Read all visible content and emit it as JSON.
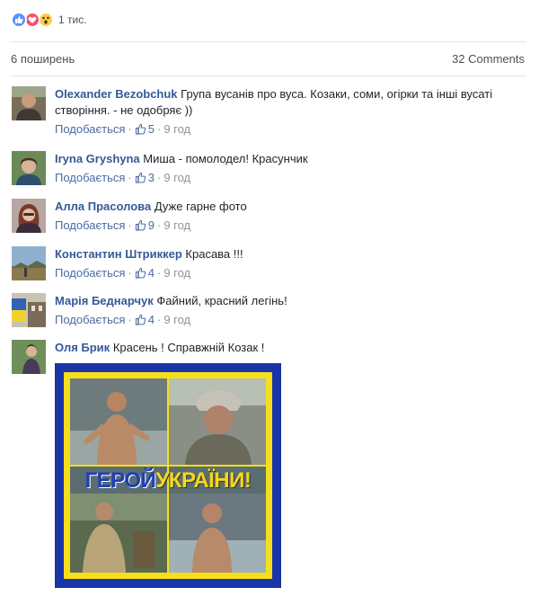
{
  "reactions": {
    "icons": [
      "like-icon",
      "love-icon",
      "wow-icon"
    ],
    "count": "1 тис."
  },
  "post_stats": {
    "shares": "6 поширень",
    "comments": "32 Comments"
  },
  "like_label": "Подобається",
  "comments": [
    {
      "author": "Olexander Bezobchuk",
      "text": "Група вусанів про вуса. Козаки, соми, огірки та інші вусаті створіння. - не одобряє ))",
      "likes": "5",
      "time": "9 год"
    },
    {
      "author": "Iryna Gryshyna",
      "text": "Миша - помолодел! Красунчик",
      "likes": "3",
      "time": "9 год"
    },
    {
      "author": "Алла Прасолова",
      "text": "Дуже гарне фото",
      "likes": "9",
      "time": "9 год"
    },
    {
      "author": "Константин Штриккер",
      "text": "Красава !!!",
      "likes": "4",
      "time": "9 год"
    },
    {
      "author": "Марія Беднарчук",
      "text": "Файний, красний легінь!",
      "likes": "4",
      "time": "9 год"
    },
    {
      "author": "Оля Брик",
      "text": "Красень ! Справжній Козак !"
    }
  ],
  "photo": {
    "banner_part1": "ГЕРОЙ",
    "banner_part2": "УКРАЇНИ!"
  },
  "colors": {
    "link": "#365899",
    "meta": "#90949c",
    "like_blue": "#5890ff",
    "love_red": "#f25268",
    "wow_yellow": "#fbcd4e",
    "frame_blue": "#1a35a8",
    "frame_yellow": "#f6df1a"
  }
}
